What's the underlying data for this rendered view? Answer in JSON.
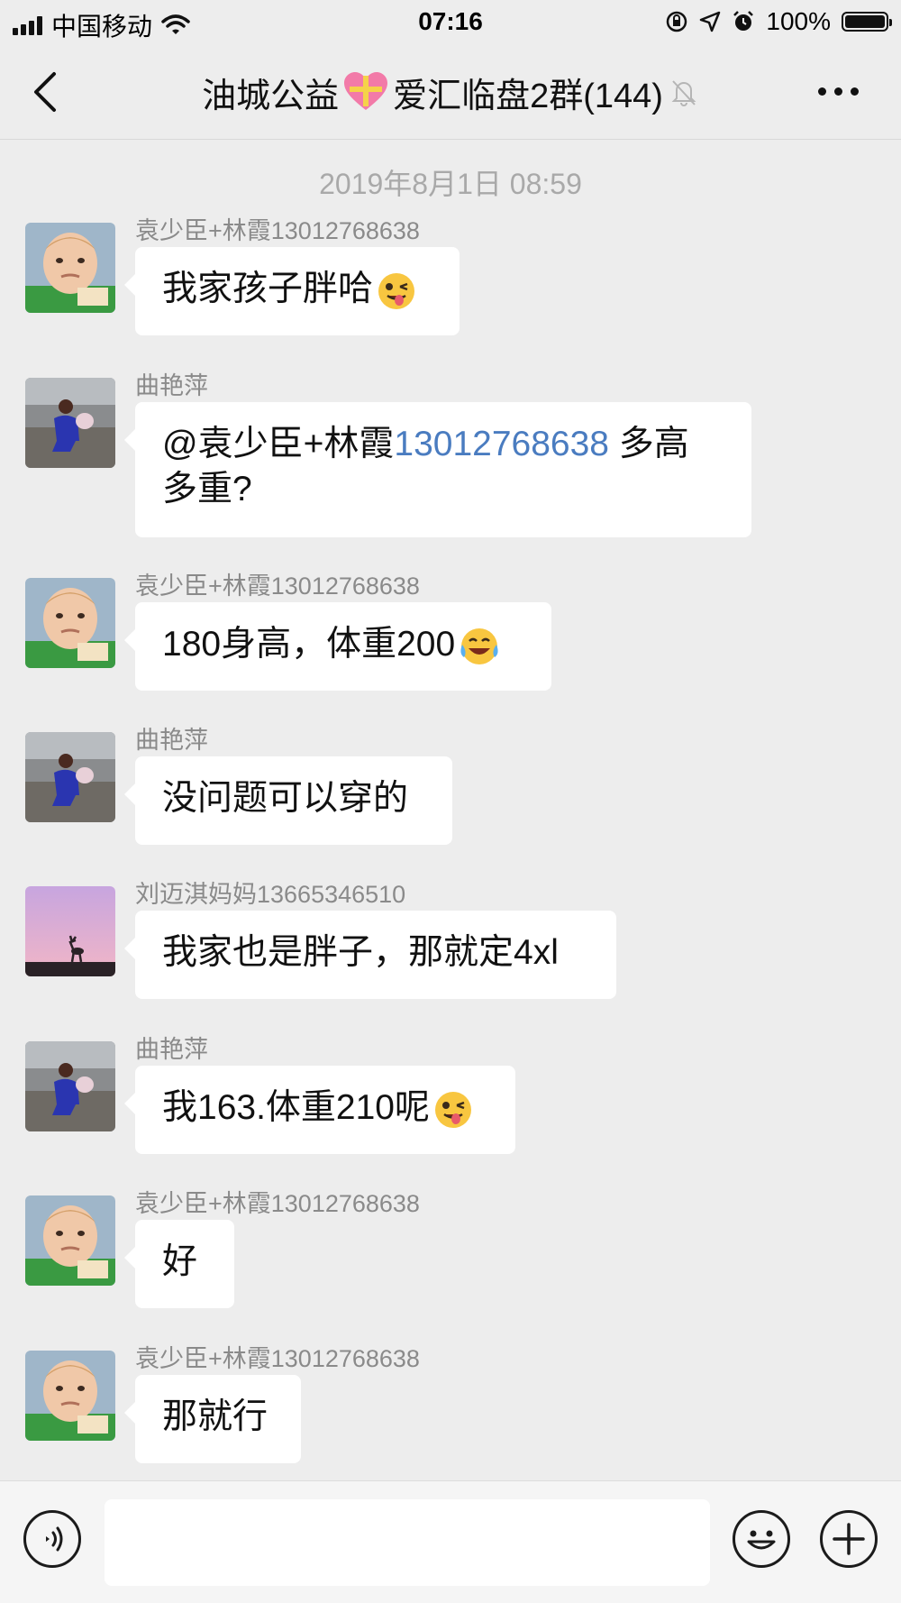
{
  "status_bar": {
    "carrier": "中国移动",
    "time": "07:16",
    "battery": "100%"
  },
  "nav": {
    "title_prefix": "油城公益",
    "title_suffix": "爱汇临盘2群(144)"
  },
  "chat": {
    "timestamp": "2019年8月1日 08:59",
    "messages": [
      {
        "sender": "袁少臣+林霞13012768638",
        "text": "我家孩子胖哈"
      },
      {
        "sender": "曲艳萍",
        "text_prefix": "@袁少臣+林霞",
        "text_number": "13012768638",
        "text_suffix": " 多高",
        "text_line2": "多重?"
      },
      {
        "sender": "袁少臣+林霞13012768638",
        "text": "180身高，体重200"
      },
      {
        "sender": "曲艳萍",
        "text": "没问题可以穿的"
      },
      {
        "sender": "刘迈淇妈妈13665346510",
        "text": "我家也是胖子，那就定4xl"
      },
      {
        "sender": "曲艳萍",
        "text": "我163.体重210呢"
      },
      {
        "sender": "袁少臣+林霞13012768638",
        "text": "好"
      },
      {
        "sender": "袁少臣+林霞13012768638",
        "text": "那就行"
      }
    ]
  },
  "colors": {
    "background": "#ededed",
    "bubble": "#ffffff",
    "mention": "#4a7cc0",
    "meta_text": "#a9a9a9"
  }
}
